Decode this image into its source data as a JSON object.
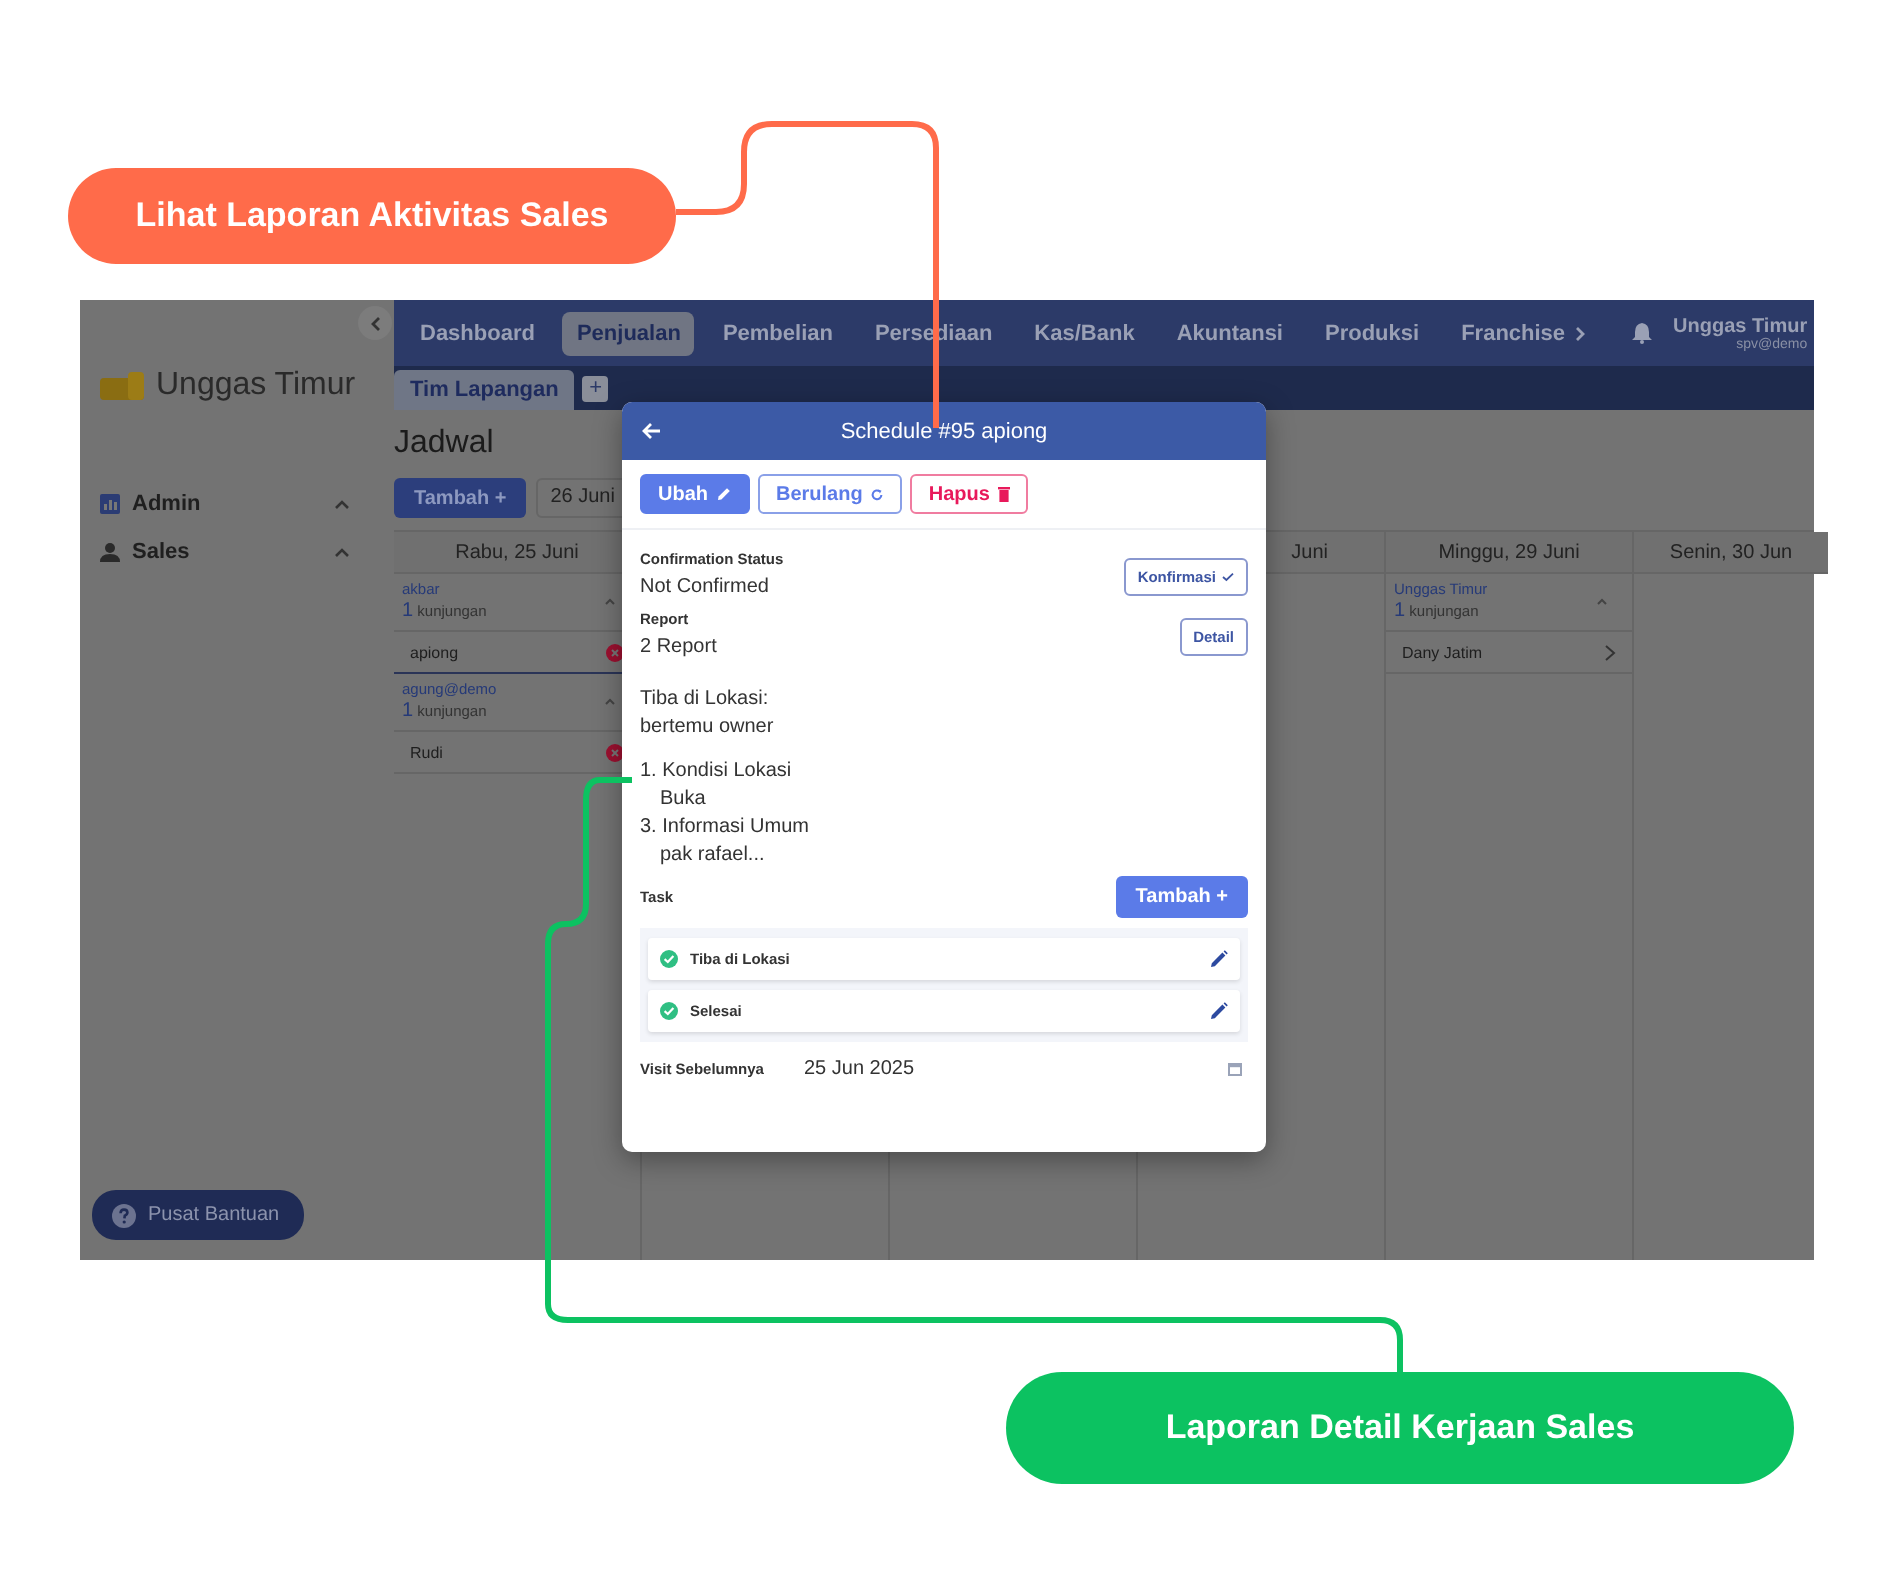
{
  "callouts": [
    {
      "text": "Lihat Laporan Aktivitas Sales",
      "color": "#ff6b4a"
    },
    {
      "text": "Laporan Detail Kerjaan Sales",
      "color": "#0cc261"
    }
  ],
  "sidebar": {
    "brand": "Unggas Timur",
    "items": [
      {
        "label": "Admin",
        "kind": "chart"
      },
      {
        "label": "Sales",
        "kind": "person"
      }
    ],
    "help_button": "Pusat Bantuan"
  },
  "topnav": {
    "items": [
      {
        "label": "Dashboard",
        "selected": false,
        "has_submenu": false
      },
      {
        "label": "Penjualan",
        "selected": true,
        "has_submenu": false
      },
      {
        "label": "Pembelian",
        "selected": false,
        "has_submenu": false
      },
      {
        "label": "Persediaan",
        "selected": false,
        "has_submenu": false
      },
      {
        "label": "Kas/Bank",
        "selected": false,
        "has_submenu": false
      },
      {
        "label": "Akuntansi",
        "selected": false,
        "has_submenu": false
      },
      {
        "label": "Produksi",
        "selected": false,
        "has_submenu": false
      },
      {
        "label": "Franchise",
        "selected": false,
        "has_submenu": true
      }
    ],
    "user": {
      "name": "Unggas Timur",
      "email": "spv@demo"
    }
  },
  "tabs": [
    {
      "label": "Tim Lapangan",
      "selected": true
    }
  ],
  "add_tab": "+",
  "page": {
    "title": "Jadwal",
    "add_button": "Tambah +",
    "date": "26 Juni"
  },
  "calendar": {
    "columns": [
      {
        "kind": "full",
        "heading": "Rabu, 25 Juni",
        "groups": [
          {
            "name": "akbar",
            "count": "1",
            "unit": "kunjungan",
            "entries": [
              {
                "name": "apiong",
                "selected": true,
                "kind": "alert"
              }
            ]
          },
          {
            "name": "agung@demo",
            "count": "1",
            "unit": "kunjungan",
            "entries": [
              {
                "name": "Rudi",
                "selected": false,
                "kind": "alert"
              }
            ]
          }
        ]
      },
      {
        "kind": "hidden"
      },
      {
        "kind": "hidden"
      },
      {
        "kind": "partial",
        "heading": "Juni"
      },
      {
        "kind": "full",
        "heading": "Minggu, 29 Juni",
        "groups": [
          {
            "name": "Unggas Timur",
            "count": "1",
            "unit": "kunjungan",
            "entries": [
              {
                "name": "Dany Jatim",
                "selected": false,
                "kind": "link"
              }
            ]
          }
        ]
      },
      {
        "kind": "full",
        "heading": "Senin, 30 Jun"
      }
    ]
  },
  "modal": {
    "title": "Schedule #95 apiong",
    "actions": [
      {
        "label": "Ubah",
        "kind": "primary"
      },
      {
        "label": "Berulang",
        "kind": "outline"
      },
      {
        "label": "Hapus",
        "kind": "danger"
      }
    ],
    "confirmation": {
      "label": "Confirmation Status",
      "value": "Not Confirmed",
      "button": "Konfirmasi"
    },
    "report": {
      "label": "Report",
      "value": "2 Report",
      "button": "Detail"
    },
    "note_lines": [
      "Tiba di Lokasi:",
      "bertemu owner"
    ],
    "note_items": [
      {
        "heading": "1. Kondisi Lokasi",
        "detail": "Buka"
      },
      {
        "heading": "3. Informasi Umum",
        "detail": "pak rafael..."
      }
    ],
    "task": {
      "label": "Task",
      "add_button": "Tambah +",
      "items": [
        {
          "label": "Tiba di Lokasi",
          "done": true
        },
        {
          "label": "Selesai",
          "done": true
        }
      ]
    },
    "visit": {
      "label": "Visit Sebelumnya",
      "value": "25 Jun 2025"
    }
  }
}
